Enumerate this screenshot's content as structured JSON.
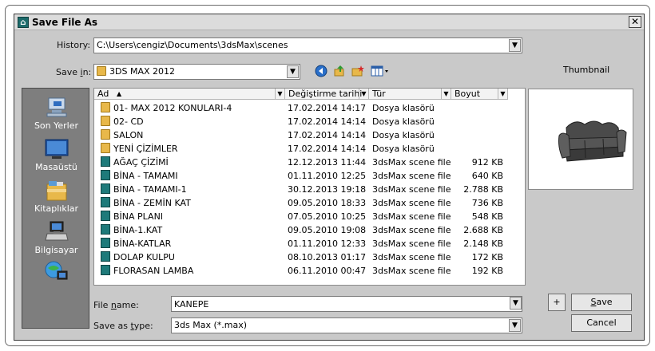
{
  "window": {
    "title": "Save File As",
    "close_glyph": "✕"
  },
  "history": {
    "label": "History:",
    "value": "C:\\Users\\cengiz\\Documents\\3dsMax\\scenes"
  },
  "save_in": {
    "label_prefix": "Save ",
    "label_hotkey": "i",
    "label_suffix": "n:",
    "value": "3DS MAX 2012"
  },
  "toolbar": {
    "back_icon": "back-icon",
    "up_icon": "up-folder-icon",
    "new_folder_icon": "new-folder-icon",
    "view_icon": "view-menu-icon"
  },
  "thumbnail": {
    "label": "Thumbnail"
  },
  "places": [
    {
      "label": "Son Yerler",
      "icon": "recent-places-icon"
    },
    {
      "label": "Masaüstü",
      "icon": "desktop-icon"
    },
    {
      "label": "Kitaplıklar",
      "icon": "libraries-icon"
    },
    {
      "label": "Bilgisayar",
      "icon": "computer-icon"
    },
    {
      "label": "",
      "icon": "network-icon"
    }
  ],
  "columns": {
    "name": "Ad",
    "date": "Değiştirme tarihi",
    "type": "Tür",
    "size": "Boyut"
  },
  "files": [
    {
      "name": "01- MAX 2012 KONULARI-4",
      "date": "17.02.2014 14:17",
      "type": "Dosya klasörü",
      "size": "",
      "kind": "folder"
    },
    {
      "name": "02- CD",
      "date": "17.02.2014 14:14",
      "type": "Dosya klasörü",
      "size": "",
      "kind": "folder"
    },
    {
      "name": "SALON",
      "date": "17.02.2014 14:14",
      "type": "Dosya klasörü",
      "size": "",
      "kind": "folder"
    },
    {
      "name": "YENİ ÇİZİMLER",
      "date": "17.02.2014 14:14",
      "type": "Dosya klasörü",
      "size": "",
      "kind": "folder"
    },
    {
      "name": "AĞAÇ ÇİZİMİ",
      "date": "12.12.2013 11:44",
      "type": "3dsMax scene file",
      "size": "912 KB",
      "kind": "max"
    },
    {
      "name": "BİNA - TAMAMI",
      "date": "01.11.2010 12:25",
      "type": "3dsMax scene file",
      "size": "640 KB",
      "kind": "max"
    },
    {
      "name": "BİNA - TAMAMI-1",
      "date": "30.12.2013 19:18",
      "type": "3dsMax scene file",
      "size": "2.788 KB",
      "kind": "max"
    },
    {
      "name": "BİNA - ZEMİN KAT",
      "date": "09.05.2010 18:33",
      "type": "3dsMax scene file",
      "size": "736 KB",
      "kind": "max"
    },
    {
      "name": "BİNA PLANI",
      "date": "07.05.2010 10:25",
      "type": "3dsMax scene file",
      "size": "548 KB",
      "kind": "max"
    },
    {
      "name": "BİNA-1.KAT",
      "date": "09.05.2010 19:08",
      "type": "3dsMax scene file",
      "size": "2.688 KB",
      "kind": "max"
    },
    {
      "name": "BİNA-KATLAR",
      "date": "01.11.2010 12:33",
      "type": "3dsMax scene file",
      "size": "2.148 KB",
      "kind": "max"
    },
    {
      "name": "DOLAP KULPU",
      "date": "08.10.2013 01:17",
      "type": "3dsMax scene file",
      "size": "172 KB",
      "kind": "max"
    },
    {
      "name": "FLORASAN LAMBA",
      "date": "06.11.2010 00:47",
      "type": "3dsMax scene file",
      "size": "192 KB",
      "kind": "max"
    }
  ],
  "file_name": {
    "label_prefix": "File ",
    "label_hotkey": "n",
    "label_suffix": "ame:",
    "value": "KANEPE"
  },
  "save_as_type": {
    "label_prefix": "Save as ",
    "label_hotkey": "t",
    "label_suffix": "ype:",
    "value": "3ds Max (*.max)"
  },
  "buttons": {
    "plus": "+",
    "save_hotkey": "S",
    "save_rest": "ave",
    "cancel": "Cancel"
  }
}
